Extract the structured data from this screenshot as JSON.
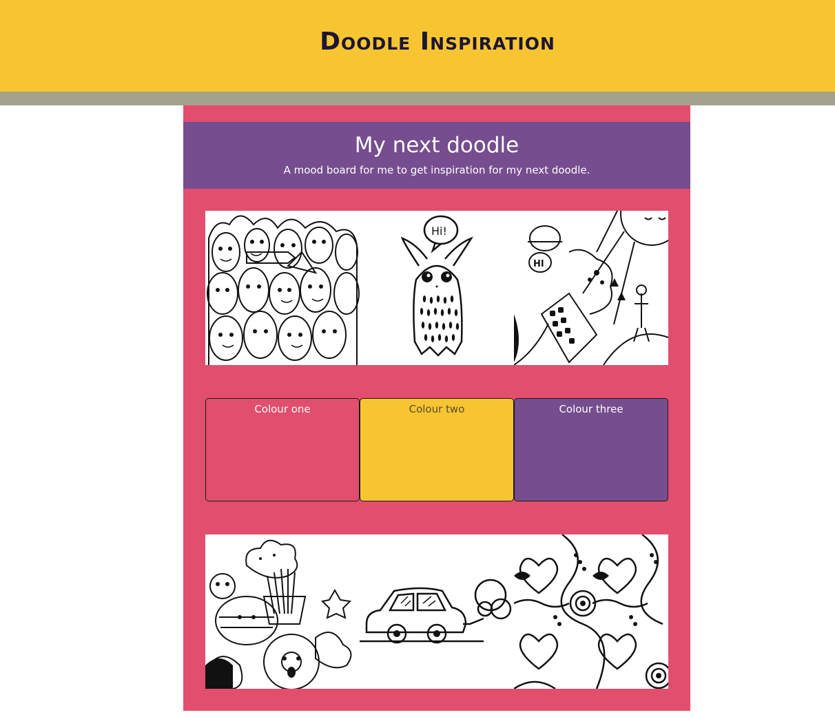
{
  "header": {
    "title": "Doodle Inspiration",
    "color": "#f7c531"
  },
  "board": {
    "title": "My next doodle",
    "subtitle": "A mood board for me to get inspiration for my next doodle.",
    "background": "#e24e6d",
    "banner_color": "#764d8e"
  },
  "images_top": [
    {
      "icon": "monster-crowd-doodle"
    },
    {
      "icon": "hi-monster-doodle",
      "text": "Hi!"
    },
    {
      "icon": "sun-city-doodle",
      "text": "HI"
    }
  ],
  "swatches": [
    {
      "label": "Colour one",
      "color": "#e24e6d"
    },
    {
      "label": "Colour two",
      "color": "#f7c531"
    },
    {
      "label": "Colour three",
      "color": "#764d8e"
    }
  ],
  "images_bottom": [
    {
      "icon": "food-characters-doodle"
    },
    {
      "icon": "car-doodle"
    },
    {
      "icon": "heart-pattern-doodle"
    }
  ]
}
